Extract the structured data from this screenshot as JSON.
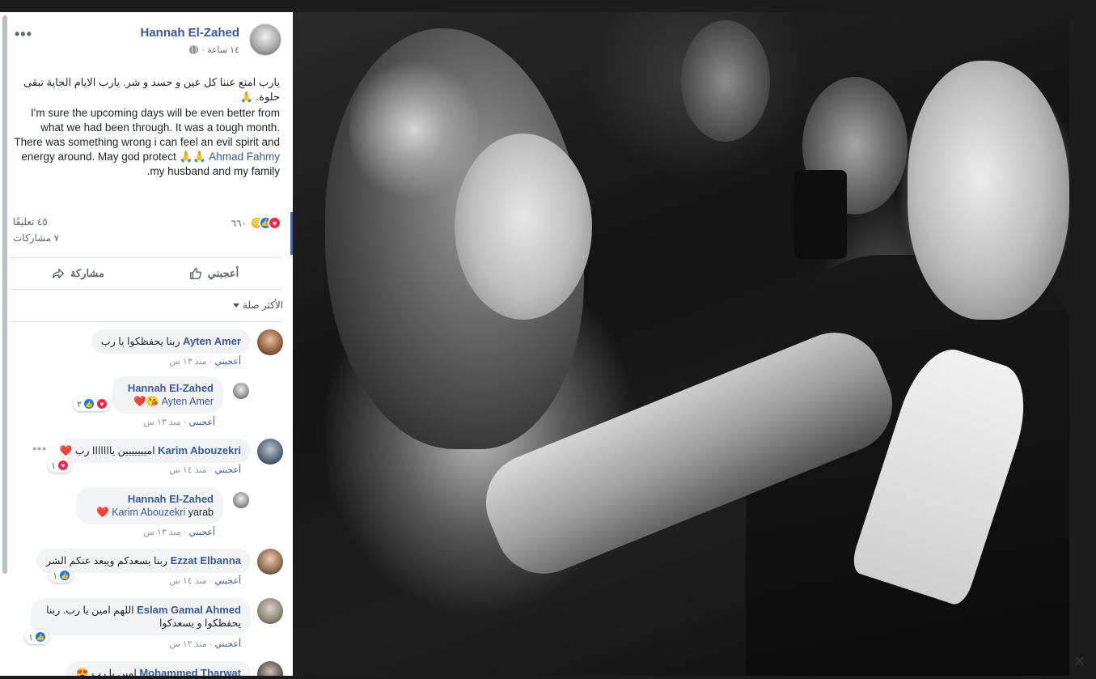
{
  "post": {
    "author": "Hannah El-Zahed",
    "time": "١٤ ساعة ·",
    "more": "•••",
    "text_ar": "يارب امنع عننا كل عين و حسد و شر. يارب الايام الجاية تبقى حلوة. 🙏",
    "text_en": "I'm sure the upcoming days will be even better from what we had been through. It was a tough month. There was something wrong i can feel an evil spirit and energy around. May god protect",
    "text_en_tail": ".my husband and my family",
    "tagged": "Ahmad Fahmy",
    "tagged_emoji": "🙏🙏",
    "reactions_count": "٦٦٠",
    "comments_count": "٤٥ تعليقًا",
    "shares_count": "٧ مشاركات"
  },
  "actions": {
    "like": "أعجبني",
    "share": "مشاركة"
  },
  "sort": {
    "label": "الأكثر صلة"
  },
  "comments": [
    {
      "name": "Ayten Amer",
      "text": "ربنا يحفظكوا يا رب",
      "like": "أعجبني",
      "time": "منذ ١٣ س"
    },
    {
      "name": "Hannah El-Zahed",
      "mention": "Ayten Amer",
      "emoji": "😘❤️",
      "like": "أعجبني",
      "time": "منذ ١٣ س",
      "reaction_count": "٢"
    },
    {
      "name": "Karim Abouzekri",
      "text": "امييييييين يااااااا رب ❤️",
      "like": "أعجبني",
      "time": "منذ ١٤ س",
      "reaction_count": "١"
    },
    {
      "name": "Hannah El-Zahed",
      "mention": "Karim Abouzekri",
      "text": "yarab",
      "emoji": "❤️",
      "like": "أعجبني",
      "time": "منذ ١٣ س"
    },
    {
      "name": "Ezzat Elbanna",
      "text": "ربنا يسعدكم ويبعد عنكم الشر",
      "like": "أعجبني",
      "time": "منذ ١٤ س",
      "reaction_count": "١"
    },
    {
      "name": "Eslam Gamal Ahmed",
      "text": "اللهم امين يا رب. ربنا يحفظكوا و يسعدكوا",
      "like": "أعجبني",
      "time": "منذ ١٢ س",
      "reaction_count": "١"
    },
    {
      "name": "Mohammed Tharwat",
      "text": "امين يا رب",
      "emoji": "😍"
    }
  ],
  "colors": {
    "link": "#385898",
    "like": "#1877f2",
    "love": "#f0284a"
  }
}
